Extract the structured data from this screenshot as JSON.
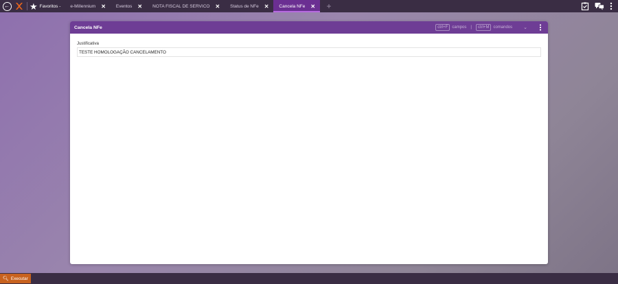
{
  "topbar": {
    "favorites_label": "Favoritos -",
    "tabs": [
      {
        "label": "e-Millennium",
        "close": "✕"
      },
      {
        "label": "Eventos",
        "close": "✕"
      },
      {
        "label": "NOTA FISCAL DE SERVICO",
        "close": "✕"
      },
      {
        "label": "Status de NFe",
        "close": "✕"
      },
      {
        "label": "Cancela NFe",
        "close": "✕",
        "active": true
      }
    ],
    "add_tab": "+"
  },
  "card": {
    "title": "Cancela NFe",
    "hint_fields_key": "ctrl+F",
    "hint_fields_label": "campos",
    "hint_separator": "|",
    "hint_commands_key": "ctrl+M",
    "hint_commands_label": "comandos",
    "field_label": "Justificativa",
    "field_value": "TESTE HOMOLOGAÇÃO CANCELAMENTO"
  },
  "bottombar": {
    "execute_label": "Executar"
  },
  "colors": {
    "topbar_bg": "#3a2d44",
    "active_tab": "#6b2f92",
    "card_header": "#6e3d95",
    "execute_button": "#c8621e"
  }
}
